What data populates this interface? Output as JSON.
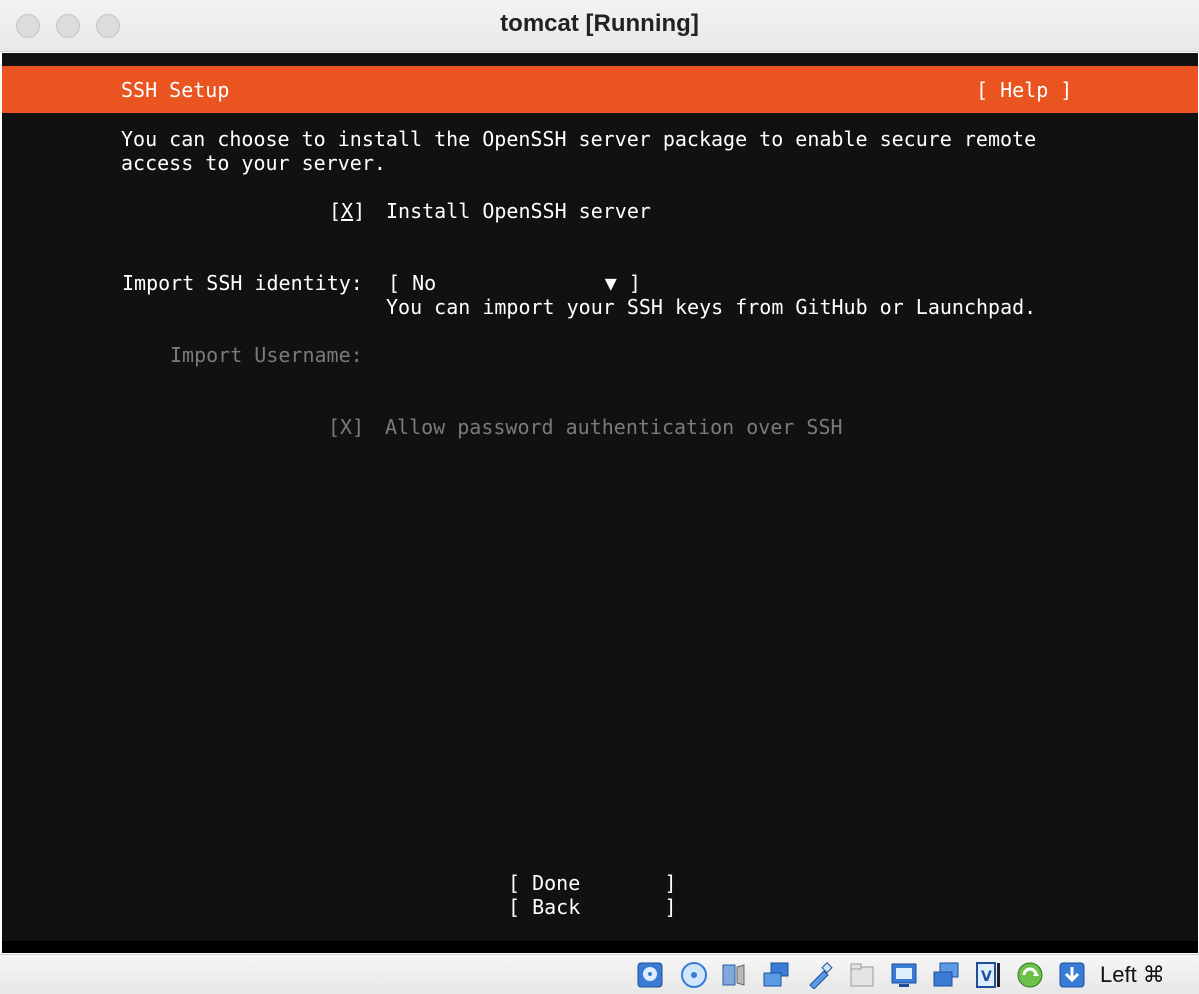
{
  "window": {
    "title": "tomcat [Running]"
  },
  "header": {
    "title": "SSH Setup",
    "help": "[ Help ]"
  },
  "intro": {
    "line1": "You can choose to install the OpenSSH server package to enable secure remote",
    "line2": "access to your server."
  },
  "install_openssh": {
    "open": "[",
    "mark": "X",
    "close": "]",
    "label": "Install OpenSSH server"
  },
  "import_identity": {
    "label": "Import SSH identity:",
    "value": "[ No              ▼ ]",
    "hint": "You can import your SSH keys from GitHub or Launchpad."
  },
  "import_username": {
    "label": "Import Username:"
  },
  "allow_password": {
    "checkbox": "[X]",
    "label": "Allow password authentication over SSH"
  },
  "buttons": {
    "done": "[ Done       ]",
    "back": "[ Back       ]"
  },
  "statusbar": {
    "host_key": "Left ⌘",
    "icons": [
      "hard-disk-icon",
      "optical-drive-icon",
      "audio-icon",
      "network-icon",
      "usb-icon",
      "shared-folders-icon",
      "display-icon",
      "capture-icon",
      "virtualbox-icon",
      "rotate-icon",
      "download-icon"
    ]
  },
  "colors": {
    "accent": "#e95420",
    "background": "#111111",
    "dimmed": "#7a7a7a"
  }
}
